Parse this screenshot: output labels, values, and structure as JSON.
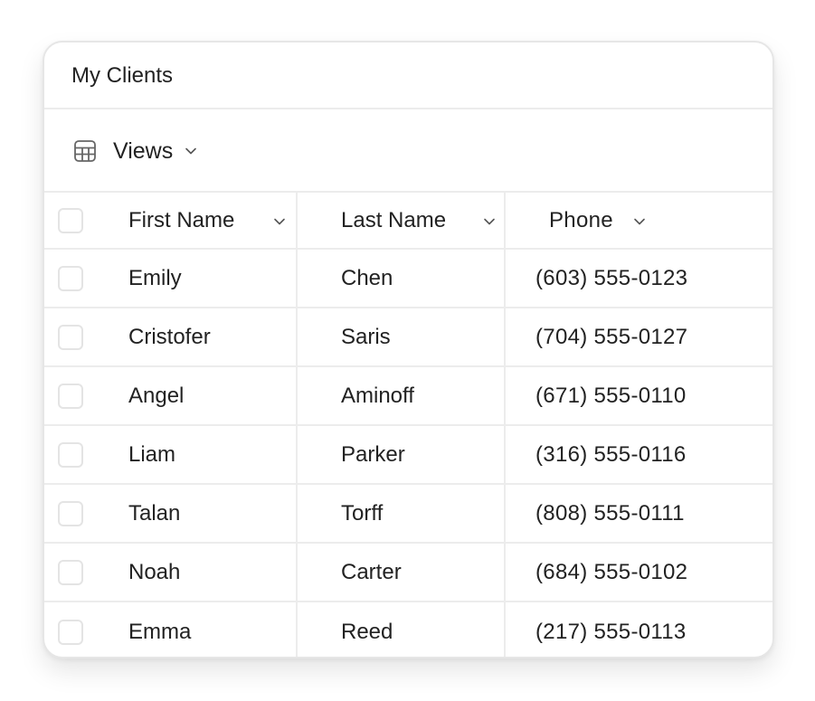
{
  "card": {
    "title": "My Clients"
  },
  "toolbar": {
    "views_label": "Views",
    "views_icon": "table-icon"
  },
  "table": {
    "columns": [
      {
        "key": "first_name",
        "label": "First Name"
      },
      {
        "key": "last_name",
        "label": "Last Name"
      },
      {
        "key": "phone",
        "label": "Phone"
      }
    ],
    "rows": [
      {
        "first_name": "Emily",
        "last_name": "Chen",
        "phone": "(603) 555-0123"
      },
      {
        "first_name": "Cristofer",
        "last_name": "Saris",
        "phone": "(704) 555-0127"
      },
      {
        "first_name": "Angel",
        "last_name": "Aminoff",
        "phone": "(671) 555-0110"
      },
      {
        "first_name": "Liam",
        "last_name": "Parker",
        "phone": "(316) 555-0116"
      },
      {
        "first_name": "Talan",
        "last_name": "Torff",
        "phone": "(808) 555-0111"
      },
      {
        "first_name": "Noah",
        "last_name": "Carter",
        "phone": "(684) 555-0102"
      },
      {
        "first_name": "Emma",
        "last_name": "Reed",
        "phone": "(217) 555-0113"
      }
    ]
  },
  "colors": {
    "border": "#ececec",
    "text": "#222222",
    "icon": "#666666"
  }
}
